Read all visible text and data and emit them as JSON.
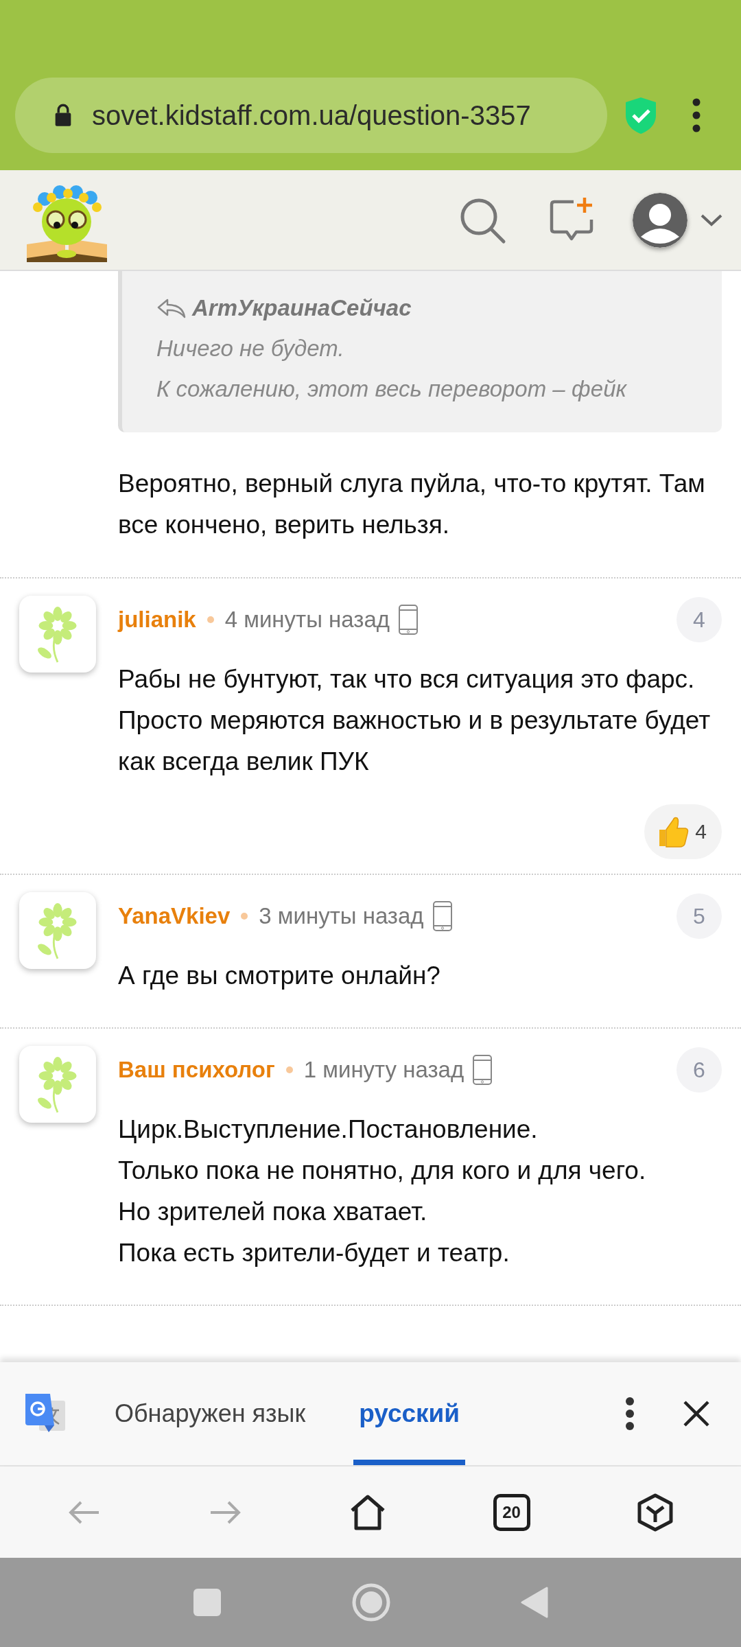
{
  "browser": {
    "url": "sovet.kidstaff.com.ua/question-3357"
  },
  "thread": {
    "partial": {
      "quote": {
        "author": "ArmУкраинаСейчас",
        "lines": [
          "Ничего не будет.",
          "К сожалению, этот весь переворот – фейк"
        ]
      },
      "text": "Вероятно, верный слуга пуйла, что-то крутят. Там все кончено, верить нельзя."
    },
    "comments": [
      {
        "author": "julianik",
        "time": "4 минуты назад",
        "number": "4",
        "paragraphs": [
          "Рабы не бунтуют, так что вся ситуация это фарс. Просто меряются важностью и в результате будет как всегда велик ПУК"
        ],
        "likes": "4"
      },
      {
        "author": "YanaVkiev",
        "time": "3 минуты назад",
        "number": "5",
        "paragraphs": [
          "А где вы смотрите онлайн?"
        ]
      },
      {
        "author": "Ваш психолог",
        "time": "1 минуту назад",
        "number": "6",
        "paragraphs": [
          "Цирк.Выступление.Постановление.",
          "Только пока не понятно, для кого и для чего.",
          "Но зрителей пока хватает.",
          "Пока есть зрители-будет и театр."
        ]
      }
    ]
  },
  "translate_bar": {
    "label": "Обнаружен язык",
    "language": {
      "text": "русский",
      "selected": true
    }
  },
  "nav": {
    "back": {
      "disabled": true
    },
    "forward": {
      "disabled": true
    },
    "tabs_count": "20"
  }
}
